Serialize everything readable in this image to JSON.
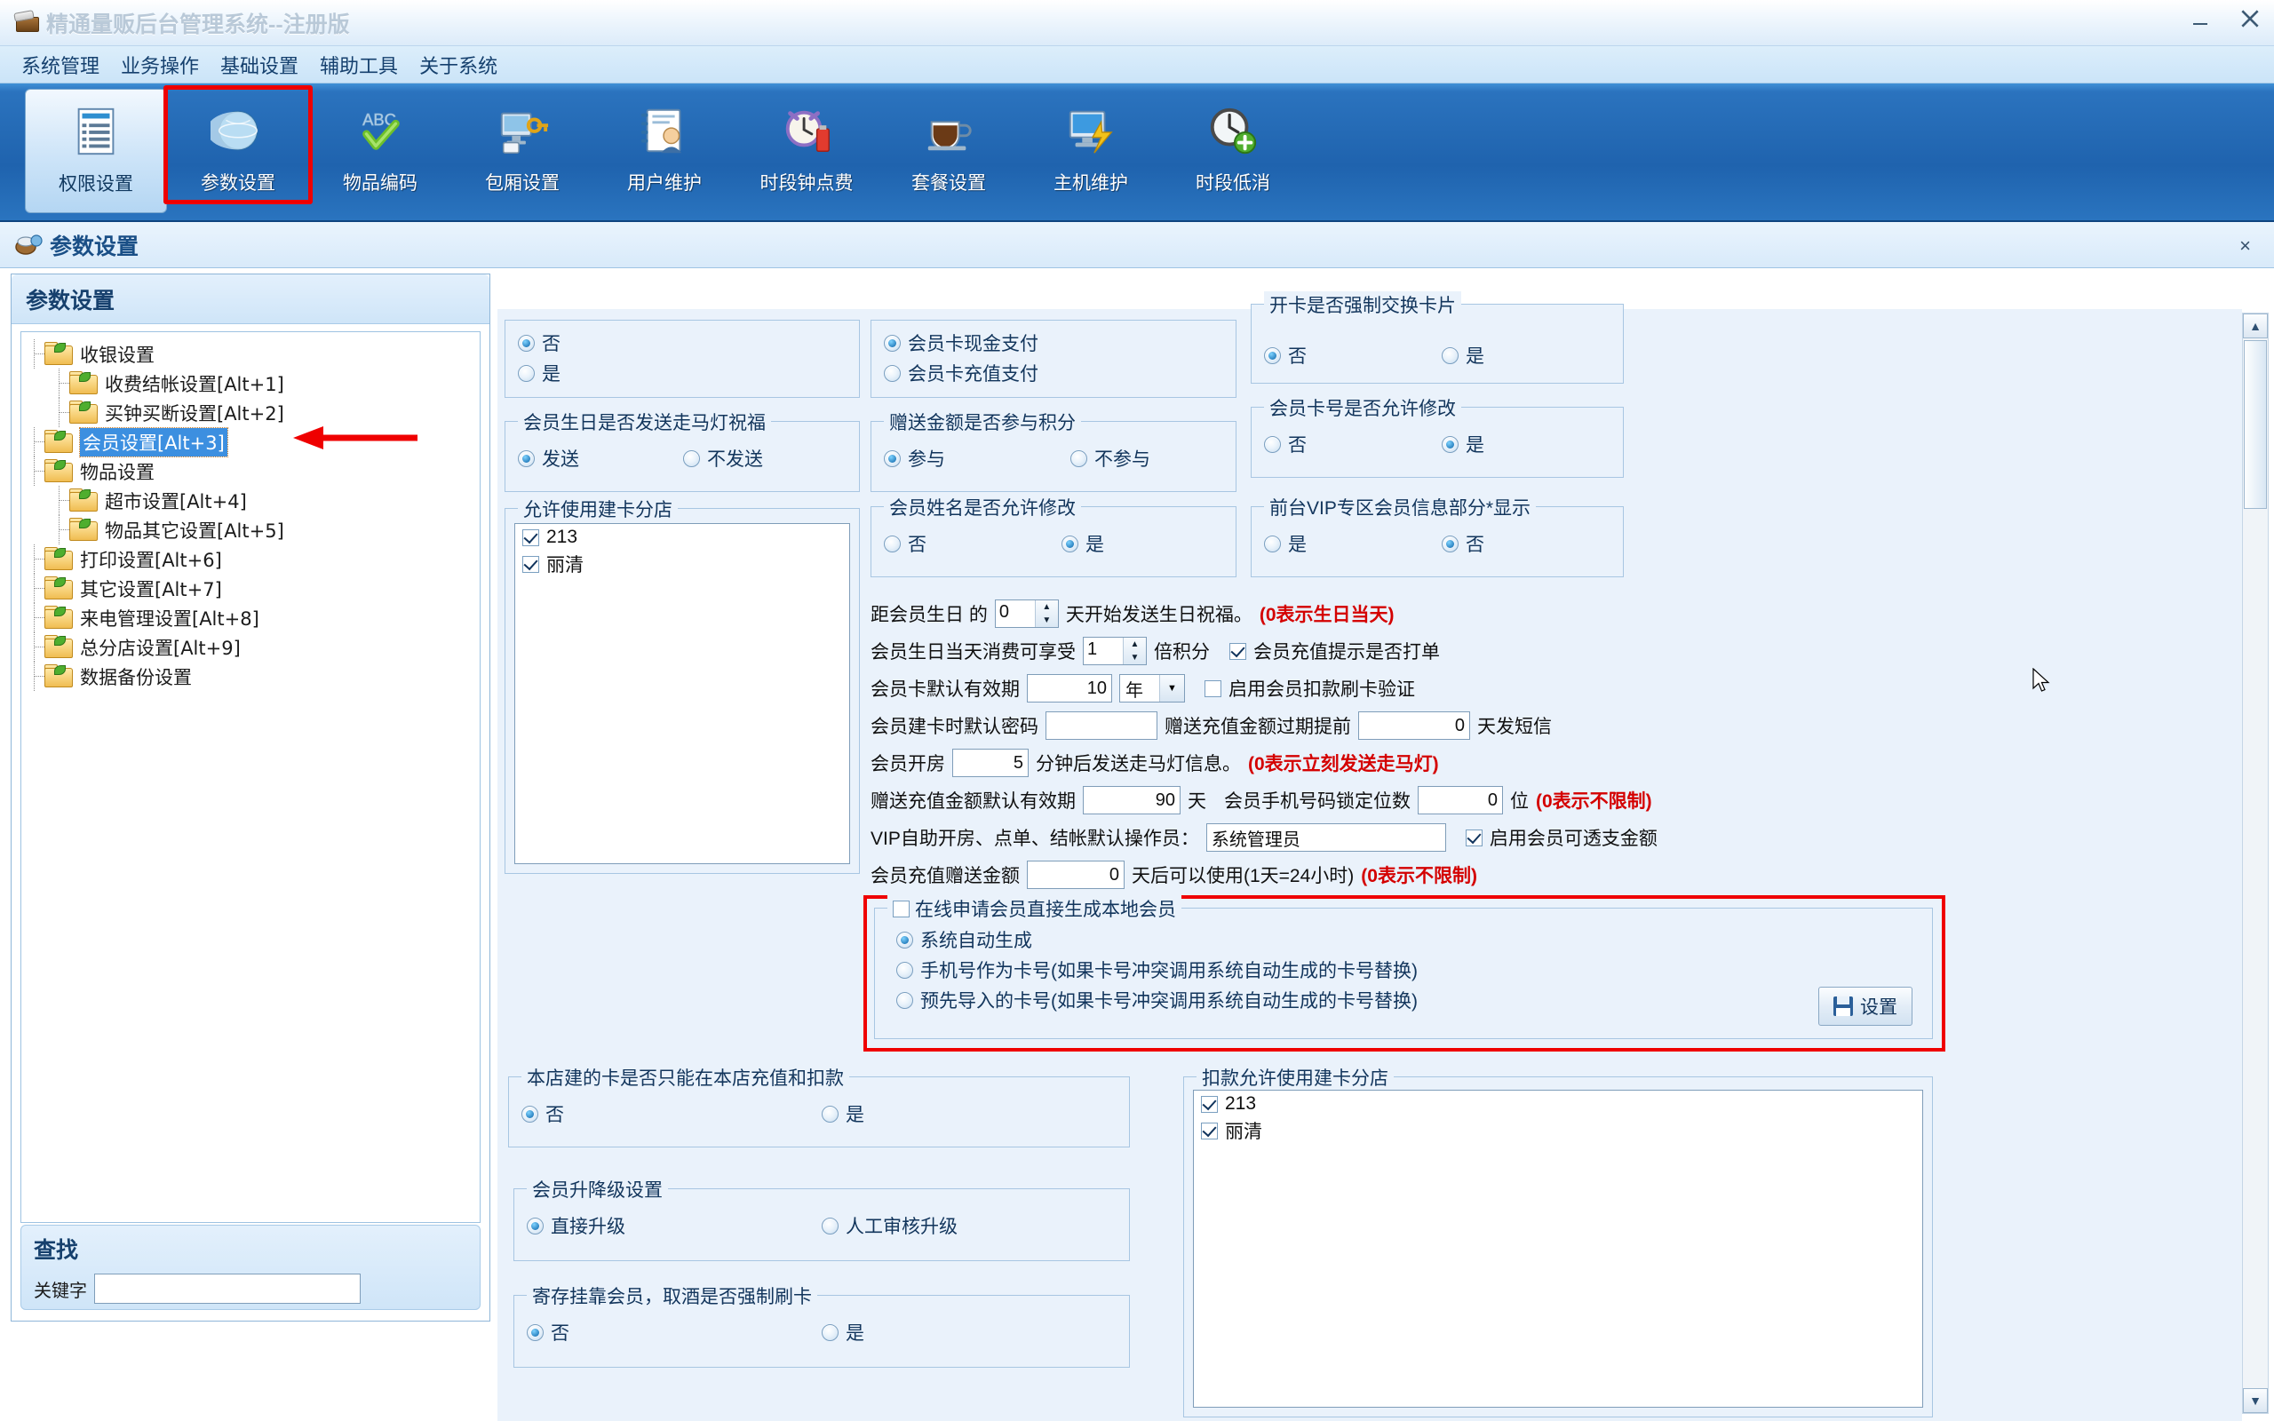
{
  "window": {
    "title": "精通量贩后台管理系统--注册版",
    "minimize_label": "最小化",
    "close_label": "关闭"
  },
  "menubar": {
    "items": [
      {
        "label": "系统管理"
      },
      {
        "label": "业务操作"
      },
      {
        "label": "基础设置"
      },
      {
        "label": "辅助工具"
      },
      {
        "label": "关于系统"
      }
    ]
  },
  "toolbar": {
    "buttons": [
      {
        "label": "权限设置",
        "icon": "list-document-icon",
        "selected": true,
        "highlighted": false
      },
      {
        "label": "参数设置",
        "icon": "globe-icon",
        "selected": false,
        "highlighted": true
      },
      {
        "label": "物品编码",
        "icon": "abc-check-icon",
        "selected": false,
        "highlighted": false
      },
      {
        "label": "包厢设置",
        "icon": "monitor-key-icon",
        "selected": false,
        "highlighted": false
      },
      {
        "label": "用户维护",
        "icon": "user-card-icon",
        "selected": false,
        "highlighted": false
      },
      {
        "label": "时段钟点费",
        "icon": "alarm-clock-icon",
        "selected": false,
        "highlighted": false
      },
      {
        "label": "套餐设置",
        "icon": "coffee-cup-icon",
        "selected": false,
        "highlighted": false
      },
      {
        "label": "主机维护",
        "icon": "monitor-bolt-icon",
        "selected": false,
        "highlighted": false
      },
      {
        "label": "时段低消",
        "icon": "clock-plus-icon",
        "selected": false,
        "highlighted": false
      }
    ]
  },
  "page_header": {
    "title": "参数设置",
    "icon": "settings-page-icon",
    "close_label": "×"
  },
  "left_panel": {
    "header_title": "参数设置",
    "tree": [
      {
        "label": "收银设置",
        "level": 1,
        "selected": false
      },
      {
        "label": "收费结帐设置[Alt+1]",
        "level": 2,
        "selected": false
      },
      {
        "label": "买钟买断设置[Alt+2]",
        "level": 2,
        "selected": false
      },
      {
        "label": "会员设置[Alt+3]",
        "level": 1,
        "selected": true
      },
      {
        "label": "物品设置",
        "level": 1,
        "selected": false
      },
      {
        "label": "超市设置[Alt+4]",
        "level": 2,
        "selected": false
      },
      {
        "label": "物品其它设置[Alt+5]",
        "level": 2,
        "selected": false
      },
      {
        "label": "打印设置[Alt+6]",
        "level": 1,
        "selected": false
      },
      {
        "label": "其它设置[Alt+7]",
        "level": 1,
        "selected": false
      },
      {
        "label": "来电管理设置[Alt+8]",
        "level": 1,
        "selected": false
      },
      {
        "label": "总分店设置[Alt+9]",
        "level": 1,
        "selected": false
      },
      {
        "label": "数据备份设置",
        "level": 1,
        "selected": false
      }
    ],
    "find": {
      "title": "查找",
      "keyword_label": "关键字",
      "keyword_value": ""
    }
  },
  "main": {
    "group_topleft": {
      "options": [
        {
          "label": "否",
          "checked": true
        },
        {
          "label": "是",
          "checked": false
        }
      ]
    },
    "group_topmid": {
      "options": [
        {
          "label": "会员卡现金支付",
          "checked": true
        },
        {
          "label": "会员卡充值支付",
          "checked": false
        }
      ]
    },
    "group_topright": {
      "title": "开卡是否强制交换卡片",
      "options": [
        {
          "label": "否",
          "checked": true
        },
        {
          "label": "是",
          "checked": false
        }
      ]
    },
    "group_birthday_marquee": {
      "title": "会员生日是否发送走马灯祝福",
      "options": [
        {
          "label": "发送",
          "checked": true
        },
        {
          "label": "不发送",
          "checked": false
        }
      ]
    },
    "group_gift_points": {
      "title": "赠送金额是否参与积分",
      "options": [
        {
          "label": "参与",
          "checked": true
        },
        {
          "label": "不参与",
          "checked": false
        }
      ]
    },
    "group_cardno_modify": {
      "title": "会员卡号是否允许修改",
      "options": [
        {
          "label": "否",
          "checked": false
        },
        {
          "label": "是",
          "checked": true
        }
      ]
    },
    "group_allowed_branches": {
      "title": "允许使用建卡分店",
      "items": [
        {
          "label": "213",
          "checked": true
        },
        {
          "label": "丽清",
          "checked": true
        }
      ]
    },
    "group_name_modify": {
      "title": "会员姓名是否允许修改",
      "options": [
        {
          "label": "否",
          "checked": false
        },
        {
          "label": "是",
          "checked": true
        }
      ]
    },
    "group_vip_display": {
      "title": "前台VIP专区会员信息部分*显示",
      "options": [
        {
          "label": "是",
          "checked": false
        },
        {
          "label": "否",
          "checked": true
        }
      ]
    },
    "rows": [
      {
        "id": "birthday_days",
        "prefix": "距会员生日 的",
        "value": "0",
        "suffix": "天开始发送生日祝福。",
        "note": "(0表示生日当天)"
      },
      {
        "id": "birthday_points",
        "prefix": "会员生日当天消费可享受",
        "value": "1",
        "suffix": "倍积分",
        "checkbox": {
          "label": "会员充值提示是否打单",
          "checked": true
        }
      },
      {
        "id": "card_validity",
        "prefix": "会员卡默认有效期",
        "value": "10",
        "unit": "年",
        "checkbox": {
          "label": "启用会员扣款刷卡验证",
          "checked": false
        }
      },
      {
        "id": "default_password",
        "prefix": "会员建卡时默认密码",
        "value": "",
        "mid_label": "赠送充值金额过期提前",
        "mid_value": "0",
        "suffix": "天发短信"
      },
      {
        "id": "open_room_marquee",
        "prefix": "会员开房",
        "value": "5",
        "suffix": "分钟后发送走马灯信息。",
        "note": "(0表示立刻发送走马灯)"
      },
      {
        "id": "gift_validity",
        "prefix": "赠送充值金额默认有效期",
        "value": "90",
        "suffix": "天",
        "mid_label": "会员手机号码锁定位数",
        "mid_value": "0",
        "unit": "位",
        "note": "(0表示不限制)"
      },
      {
        "id": "vip_operator",
        "prefix": "VIP自助开房、点单、结帐默认操作员：",
        "value": "系统管理员",
        "checkbox": {
          "label": "启用会员可透支金额",
          "checked": true
        }
      },
      {
        "id": "recharge_gift",
        "prefix": "会员充值赠送金额",
        "value": "0",
        "suffix": "天后可以使用(1天=24小时)",
        "note": "(0表示不限制)"
      }
    ],
    "group_online_apply": {
      "title": "在线申请会员直接生成本地会员",
      "title_checked": false,
      "options": [
        {
          "label": "系统自动生成",
          "checked": true
        },
        {
          "label": "手机号作为卡号(如果卡号冲突调用系统自动生成的卡号替换)",
          "checked": false
        },
        {
          "label": "预先导入的卡号(如果卡号冲突调用系统自动生成的卡号替换)",
          "checked": false
        }
      ],
      "save_button": "设置"
    },
    "group_local_only": {
      "title": "本店建的卡是否只能在本店充值和扣款",
      "options": [
        {
          "label": "否",
          "checked": true
        },
        {
          "label": "是",
          "checked": false
        }
      ]
    },
    "group_deduct_branches": {
      "title": "扣款允许使用建卡分店",
      "items": [
        {
          "label": "213",
          "checked": true
        },
        {
          "label": "丽清",
          "checked": true
        }
      ]
    },
    "group_upgrade": {
      "title": "会员升降级设置",
      "options": [
        {
          "label": "直接升级",
          "checked": true
        },
        {
          "label": "人工审核升级",
          "checked": false
        }
      ]
    },
    "group_deposit": {
      "title": "寄存挂靠会员，取酒是否强制刷卡",
      "options": [
        {
          "label": "否",
          "checked": true
        },
        {
          "label": "是",
          "checked": false
        }
      ]
    }
  },
  "colors": {
    "toolbar_blue": "#1f63ae",
    "highlight_red": "#ef0000",
    "note_red": "#d40000",
    "label_blue": "#12355c",
    "selection_blue": "#3c8fe0"
  }
}
